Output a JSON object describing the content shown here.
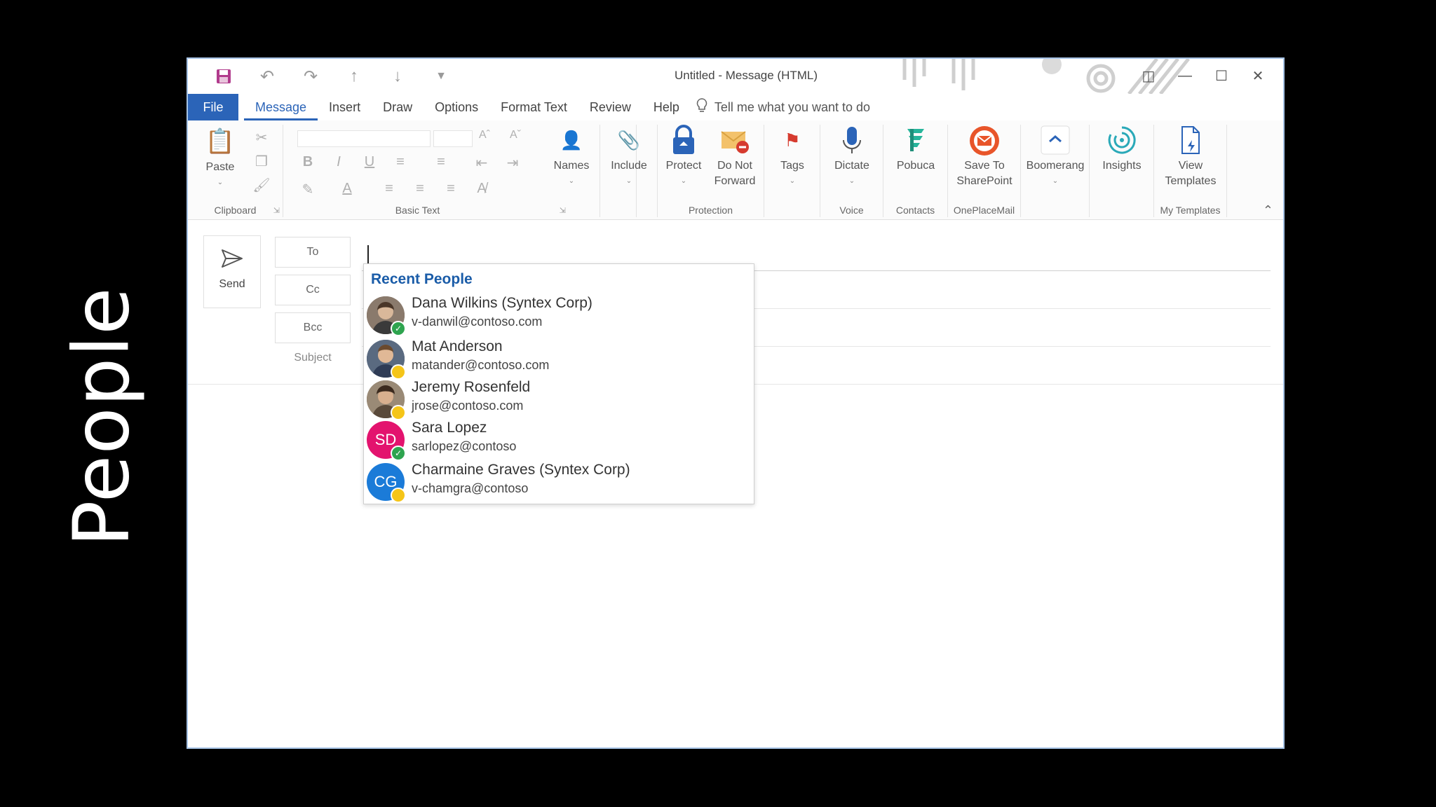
{
  "slide_label": "People",
  "window": {
    "title": "Untitled  -  Message (HTML)"
  },
  "tabs": [
    {
      "label": "File"
    },
    {
      "label": "Message"
    },
    {
      "label": "Insert"
    },
    {
      "label": "Draw"
    },
    {
      "label": "Options"
    },
    {
      "label": "Format Text"
    },
    {
      "label": "Review"
    },
    {
      "label": "Help"
    }
  ],
  "tell_me": "Tell me what you want to do",
  "ribbon": {
    "paste": "Paste",
    "names": "Names",
    "include": "Include",
    "protect": "Protect",
    "do_not_forward": "Do Not Forward",
    "tags": "Tags",
    "dictate": "Dictate",
    "pobuca": "Pobuca",
    "save_to_sharepoint": "Save To SharePoint",
    "boomerang": "Boomerang",
    "insights": "Insights",
    "view_templates": "View Templates",
    "groups": {
      "clipboard": "Clipboard",
      "basic_text": "Basic Text",
      "protection": "Protection",
      "voice": "Voice",
      "contacts": "Contacts",
      "oneplacemail": "OnePlaceMail",
      "my_templates": "My Templates"
    }
  },
  "compose": {
    "send": "Send",
    "to": "To",
    "cc": "Cc",
    "bcc": "Bcc",
    "subject": "Subject"
  },
  "recent_people": {
    "header": "Recent People",
    "people": [
      {
        "name": "Dana Wilkins (Syntex Corp)",
        "email": "v-danwil@contoso.com",
        "initials": "",
        "presence": "available",
        "color": "#6b5b4e"
      },
      {
        "name": "Mat Anderson",
        "email": "matander@contoso.com",
        "initials": "",
        "presence": "away",
        "color": "#4f5d73"
      },
      {
        "name": "Jeremy Rosenfeld",
        "email": "jrose@contoso.com",
        "initials": "",
        "presence": "away",
        "color": "#7a6a55"
      },
      {
        "name": "Sara Lopez",
        "email": "sarlopez@contoso",
        "initials": "SD",
        "presence": "available",
        "color": "#e3136e"
      },
      {
        "name": "Charmaine Graves (Syntex Corp)",
        "email": "v-chamgra@contoso",
        "initials": "CG",
        "presence": "away",
        "color": "#1b7bd8"
      }
    ]
  }
}
